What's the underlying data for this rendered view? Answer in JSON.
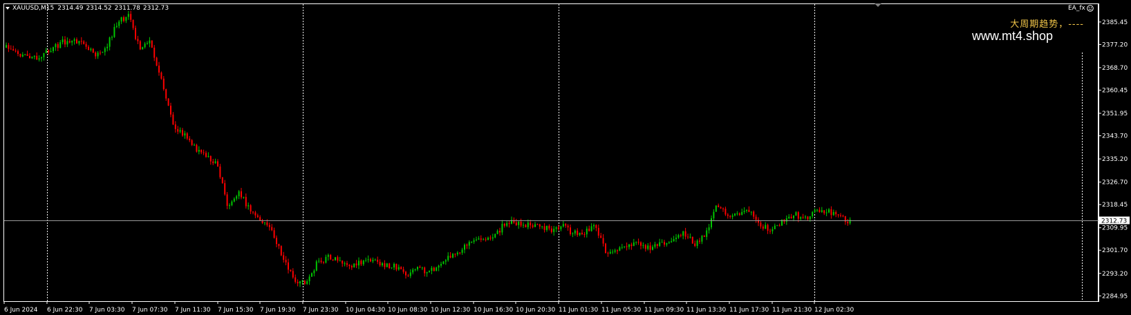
{
  "header": {
    "symbol": "XAUUSD,M15",
    "open": "2314.49",
    "high": "2314.52",
    "low": "2311.78",
    "close": "2312.73"
  },
  "ea_label": "EA_fx",
  "ea_icon": "smiley-icon",
  "menu_icon": "triangle-down-icon",
  "trend_text": "大周期趋势，----",
  "watermark": "www.mt4.shop",
  "colors": {
    "background": "#000000",
    "bull": "#00c800",
    "bear": "#ff0000",
    "grid": "#ffffff",
    "trend_text": "#f2c649",
    "bid_line": "#9a9a9a"
  },
  "chart_data": {
    "type": "candlestick",
    "symbol": "XAUUSD",
    "timeframe": "M15",
    "ylim": [
      2283,
      2392
    ],
    "yticks": [
      "2385.45",
      "2377.20",
      "2368.70",
      "2360.45",
      "2351.95",
      "2343.70",
      "2335.20",
      "2326.70",
      "2318.45",
      "2309.95",
      "2301.70",
      "2293.20",
      "2284.95"
    ],
    "xticks": [
      "6 Jun 2024",
      "6 Jun 22:30",
      "7 Jun 03:30",
      "7 Jun 07:30",
      "7 Jun 11:30",
      "7 Jun 15:30",
      "7 Jun 19:30",
      "7 Jun 23:30",
      "10 Jun 04:30",
      "10 Jun 08:30",
      "10 Jun 12:30",
      "10 Jun 16:30",
      "10 Jun 20:30",
      "11 Jun 01:30",
      "11 Jun 05:30",
      "11 Jun 09:30",
      "11 Jun 13:30",
      "11 Jun 17:30",
      "11 Jun 21:30",
      "12 Jun 02:30"
    ],
    "current_price": "2312.73",
    "price_path": [
      2376,
      2374,
      2372,
      2373,
      2375,
      2378,
      2379,
      2378,
      2373,
      2376,
      2385,
      2388,
      2376,
      2378,
      2364,
      2348,
      2344,
      2339,
      2336,
      2333,
      2317,
      2323,
      2316,
      2312,
      2308,
      2298,
      2290,
      2290,
      2297,
      2299,
      2298,
      2296,
      2297,
      2298,
      2296,
      2296,
      2292,
      2296,
      2293,
      2297,
      2299,
      2302,
      2305,
      2305,
      2307,
      2312,
      2312,
      2311,
      2311,
      2309,
      2311,
      2308,
      2308,
      2311,
      2301,
      2302,
      2303,
      2304,
      2302,
      2304,
      2305,
      2308,
      2304,
      2307,
      2318,
      2315,
      2315,
      2317,
      2311,
      2309,
      2313,
      2315,
      2313,
      2316,
      2316,
      2314,
      2312
    ]
  }
}
